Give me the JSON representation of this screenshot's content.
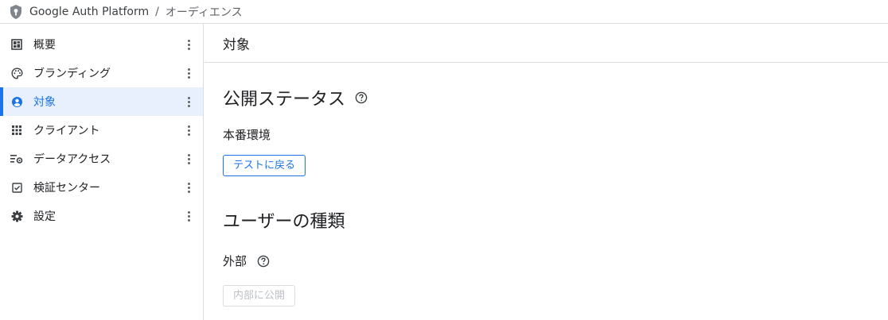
{
  "breadcrumb": {
    "product": "Google Auth Platform",
    "separator": "/",
    "current": "オーディエンス"
  },
  "sidebar": {
    "items": [
      {
        "label": "概要",
        "icon": "dashboard-icon",
        "active": false
      },
      {
        "label": "ブランディング",
        "icon": "palette-icon",
        "active": false
      },
      {
        "label": "対象",
        "icon": "account-circle-icon",
        "active": true
      },
      {
        "label": "クライアント",
        "icon": "apps-grid-icon",
        "active": false
      },
      {
        "label": "データアクセス",
        "icon": "data-settings-icon",
        "active": false
      },
      {
        "label": "検証センター",
        "icon": "checkbox-icon",
        "active": false
      },
      {
        "label": "設定",
        "icon": "gear-icon",
        "active": false
      }
    ]
  },
  "main": {
    "title": "対象",
    "publish_status": {
      "heading": "公開ステータス",
      "value": "本番環境",
      "button": "テストに戻る"
    },
    "user_type": {
      "heading": "ユーザーの種類",
      "value": "外部",
      "button": "内部に公開"
    }
  },
  "colors": {
    "accent": "#1a73e8",
    "active_bg": "#e8f0fe",
    "divider": "#dadce0"
  }
}
